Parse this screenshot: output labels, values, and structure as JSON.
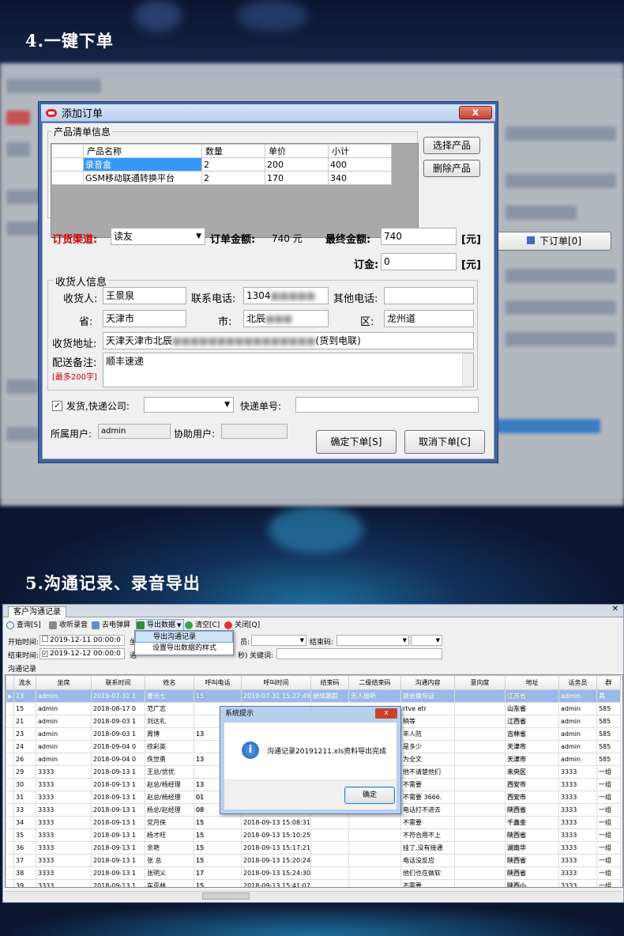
{
  "sections": {
    "s4": "4.一键下单",
    "s5": "5.沟通记录、录音导出"
  },
  "order_dialog": {
    "title": "添加订单",
    "close": "x",
    "products_group": "产品清单信息",
    "columns": [
      "产品名称",
      "数量",
      "单价",
      "小计"
    ],
    "rows": [
      [
        "录音盒",
        "2",
        "200",
        "400"
      ],
      [
        "GSM移动联通转换平台",
        "2",
        "170",
        "340"
      ]
    ],
    "btn_select": "选择产品",
    "btn_delete": "删除产品",
    "channel_label": "订货渠道:",
    "channel_value": "读友",
    "amount_label": "订单金额:",
    "amount_value": "740 元",
    "final_label": "最终金额:",
    "final_value": "740",
    "unit": "[元]",
    "deposit_label": "订金:",
    "deposit_value": "0",
    "unit2": "[元]",
    "recv_group": "收货人信息",
    "recv_label": "收货人:",
    "recv_value": "王景泉",
    "phone_label": "联系电话:",
    "phone_value": "1304",
    "other_phone_label": "其他电话:",
    "prov_label": "省:",
    "prov_value": "天津市",
    "city_label": "市:",
    "city_value": "北辰",
    "dist_label": "区:",
    "dist_value": "龙州道",
    "addr_label": "收货地址:",
    "addr_value": "天津天津市北辰",
    "addr_tail": "(货到电联)",
    "note_label": "配送备注:",
    "note_value": "顺丰速递",
    "note_limit": "[最多200字]",
    "ship_label": "发货,快递公司:",
    "tracking_label": "快递单号:",
    "owner_label": "所属用户:",
    "owner_value": "admin",
    "assist_label": "协助用户:",
    "btn_ok": "确定下单[S]",
    "btn_cancel": "取消下单[C]",
    "bg_button": "下订单[0]"
  },
  "comm_app": {
    "tab": "客户沟通记录",
    "toolbar": [
      "查询[S]",
      "收听录音",
      "去电弹屏",
      "导出数据",
      "清空[C]",
      "关闭[Q]"
    ],
    "menu": [
      "导出沟通记录",
      "设置导出数据的样式"
    ],
    "start_label": "开始时间:",
    "start_value": "2019-12-11 00:00:0",
    "end_label": "结束时间:",
    "end_value": "2019-12-12 00:00:0",
    "agent_label": "员:",
    "endcode_label": "结束码:",
    "kw_label": "关键词:",
    "sec_label": "秒)",
    "seat_short": "坐",
    "comm_short": "通",
    "list_title": "沟通记录",
    "columns": [
      "流水",
      "坐席",
      "联系时间",
      "姓名",
      "呼叫电话",
      "呼叫时间",
      "结束码",
      "二级结束码",
      "沟通内容",
      "意向度",
      "地址",
      "话务员",
      "群"
    ],
    "rows": [
      [
        "13",
        "admin",
        "2019-07-31 1",
        "曹元七",
        "15",
        "2019-07-31 15:27:49",
        "继续跟踪",
        "无人接听",
        "就会换句话",
        "",
        "江苏省",
        "admin",
        "其"
      ],
      [
        "15",
        "admin",
        "2018-08-17 0",
        "范广志",
        "",
        "",
        "",
        "",
        "rtve etr",
        "",
        "山东省",
        "admin",
        "585"
      ],
      [
        "21",
        "admin",
        "2018-09-03 1",
        "刘达礼",
        "",
        "",
        "",
        "",
        "稍等",
        "",
        "江西省",
        "admin",
        "585"
      ],
      [
        "23",
        "admin",
        "2018-09-03 1",
        "周博",
        "13",
        "",
        "",
        "",
        "丰人防",
        "",
        "吉林省",
        "admin",
        "585"
      ],
      [
        "24",
        "admin",
        "2018-09-04 0",
        "徐彩英",
        "",
        "",
        "",
        "",
        "是多少",
        "",
        "天津市",
        "admin",
        "585"
      ],
      [
        "26",
        "admin",
        "2018-09-04 0",
        "佚世勇",
        "13",
        "",
        "",
        "",
        "为全文",
        "",
        "天津市",
        "admin",
        "585"
      ],
      [
        "29",
        "3333",
        "2018-09-13 1",
        "王总/优优",
        "",
        "",
        "",
        "",
        "他不请楚他们",
        "",
        "未央区",
        "3333",
        "一组"
      ],
      [
        "30",
        "3333",
        "2018-09-13 1",
        "赵总/杨经理",
        "13",
        "",
        "",
        "",
        "不需要",
        "",
        "西安市",
        "3333",
        "一组"
      ],
      [
        "31",
        "3333",
        "2018-09-13 1",
        "赵总/杨经理",
        "01",
        "",
        "",
        "",
        "不需要   3666.",
        "",
        "西安市",
        "3333",
        "一组"
      ],
      [
        "33",
        "3333",
        "2018-09-13 1",
        "杨总/赵经理",
        "08",
        "",
        "",
        "",
        "电话打不进去",
        "",
        "陕西省",
        "3333",
        "一组"
      ],
      [
        "34",
        "3333",
        "2018-09-13 1",
        "党月侠",
        "15",
        "2018-09-13 15:08:31",
        "",
        "",
        "不需要",
        "",
        "千鑫金",
        "3333",
        "一组"
      ],
      [
        "35",
        "3333",
        "2018-09-13 1",
        "杨才旺",
        "15",
        "2018-09-13 15:10:25",
        "",
        "",
        "不符合用不上",
        "",
        "陕西省",
        "3333",
        "一组"
      ],
      [
        "36",
        "3333",
        "2018-09-13 1",
        "余艳",
        "15",
        "2018-09-13 15:17:21",
        "",
        "",
        "挂了,没有接通",
        "",
        "湖南华",
        "3333",
        "一组"
      ],
      [
        "37",
        "3333",
        "2018-09-13 1",
        "张 总",
        "15",
        "2018-09-13 15:20:24",
        "",
        "",
        "电话没反应",
        "",
        "陕西省",
        "3333",
        "一组"
      ],
      [
        "38",
        "3333",
        "2018-09-13 1",
        "张明义",
        "17",
        "2018-09-13 15:24:30",
        "",
        "",
        "他们也在做软",
        "",
        "陕西省",
        "3333",
        "一组"
      ],
      [
        "39",
        "3333",
        "2018-09-13 1",
        "车亚林",
        "15",
        "2018-09-13 15:41:07",
        "",
        "",
        "不需要",
        "",
        "陕西小",
        "3333",
        "一组"
      ]
    ],
    "msg": {
      "title": "系统提示",
      "close": "x",
      "text": "沟通记录20191211.xls资料导出完成",
      "ok": "确定"
    }
  },
  "colors": {
    "title_red": "#cc0000",
    "accent": "#3399ff"
  }
}
